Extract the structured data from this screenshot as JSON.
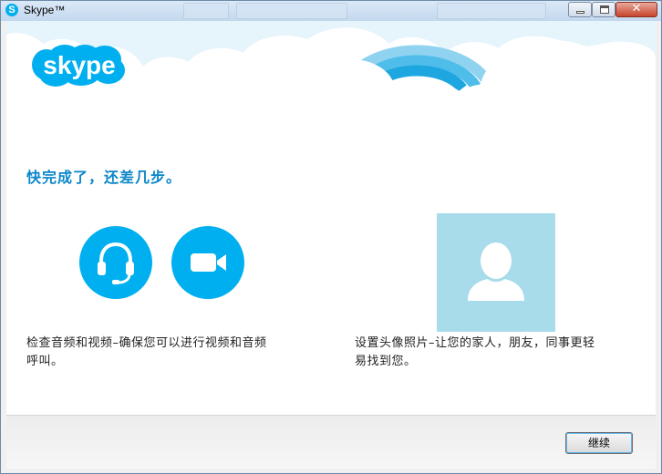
{
  "window": {
    "title": "Skype™",
    "app_icon_letter": "S",
    "controls": {
      "minimize_icon": "minimize-icon",
      "maximize_icon": "maximize-icon",
      "close_icon": "close-icon",
      "close_glyph": "✕"
    }
  },
  "brand": {
    "logo_text": "skype",
    "logo_color": "#00aff0"
  },
  "main": {
    "heading": "快完成了，还差几步。",
    "audio_video": {
      "headset_icon": "headset-icon",
      "camera_icon": "video-camera-icon",
      "description_line1": "检查音频和视频–确保您可以进行视频和音频",
      "description_line2": "呼叫。"
    },
    "profile_photo": {
      "avatar_icon": "user-avatar-icon",
      "description_line1": "设置头像照片–让您的家人，朋友，同事更轻",
      "description_line2": "易找到您。"
    }
  },
  "footer": {
    "continue_label": "继续"
  },
  "colors": {
    "accent": "#00aff0",
    "heading": "#0b86c9",
    "avatar_bg": "#a8dcea"
  }
}
